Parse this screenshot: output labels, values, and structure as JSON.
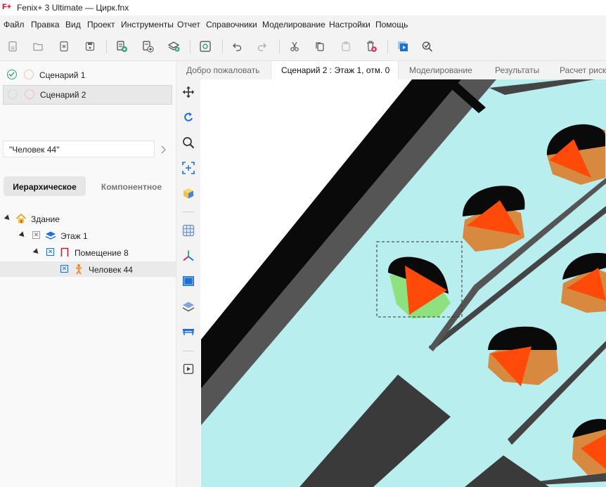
{
  "app": {
    "logo": "F+",
    "title": "Fenix+ 3 Ultimate — Цирк.fnx"
  },
  "menu": [
    "Файл",
    "Правка",
    "Вид",
    "Проект",
    "Инструменты",
    "Отчет",
    "Справочники",
    "Моделирование",
    "Настройки",
    "Помощь"
  ],
  "toolbar": {
    "buttons": [
      "new-file-icon",
      "open-folder-icon",
      "close-file-icon",
      "save-icon",
      "add-scenario-icon",
      "add-scenario-alt-icon",
      "add-layer-icon",
      "ar-view-icon",
      "undo-icon",
      "redo-icon",
      "cut-icon",
      "copy-icon",
      "paste-icon",
      "delete-icon",
      "run-calculation-icon",
      "check-icon"
    ]
  },
  "scenarios": [
    {
      "label": "Сценарий 1",
      "checked": true,
      "selected": false
    },
    {
      "label": "Сценарий 2",
      "checked": false,
      "selected": true
    }
  ],
  "search": {
    "value": "\"Человек 44\""
  },
  "view_tabs": {
    "hierarchical": "Иерархическое",
    "component": "Компонентное",
    "active": "hierarchical"
  },
  "tree": [
    {
      "label": "Здание",
      "level": 0,
      "icon": "building-icon",
      "checkbox": false
    },
    {
      "label": "Этаж 1",
      "level": 1,
      "icon": "floor-layers-icon",
      "checkbox": true
    },
    {
      "label": "Помещение 8",
      "level": 2,
      "icon": "room-icon",
      "checkbox": true
    },
    {
      "label": "Человек 44",
      "level": 3,
      "icon": "person-icon",
      "checkbox": true,
      "selected": true
    }
  ],
  "tools": [
    "move-icon",
    "rotate-icon",
    "zoom-icon",
    "fit-view-icon",
    "cube-icon",
    "grid-icon",
    "axes-icon",
    "plan-view-icon",
    "layers-icon",
    "bench-icon",
    "play-video-icon"
  ],
  "doc_tabs": [
    {
      "label": "Добро пожаловать",
      "active": false
    },
    {
      "label": "Сценарий 2 : Этаж 1, отм. 0",
      "active": true
    },
    {
      "label": "Моделирование",
      "active": false
    },
    {
      "label": "Результаты",
      "active": false
    },
    {
      "label": "Расчет риска",
      "active": false
    }
  ],
  "colors": {
    "floor": "#b8eeee",
    "wall_dark": "#555555",
    "wall_black": "#0a0a0a",
    "person_orange": "#ff4a0a",
    "person_brown": "#d6893f",
    "person_selected": "#8fe07f",
    "accent_green": "#2fa37a"
  }
}
